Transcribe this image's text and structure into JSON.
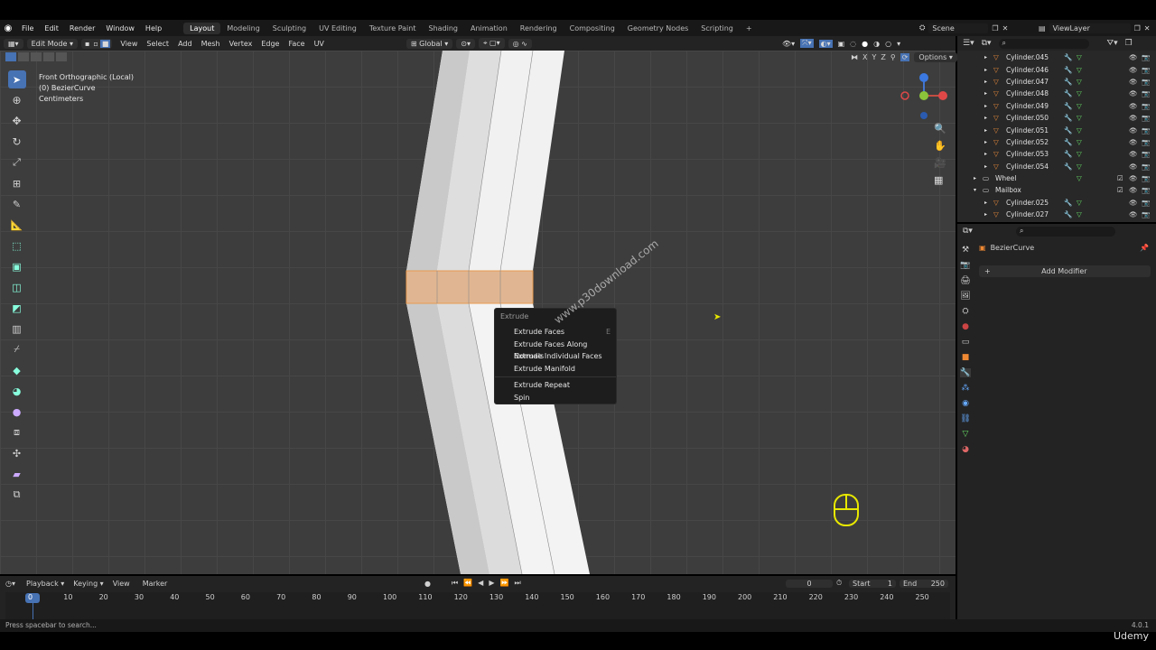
{
  "menu": [
    "File",
    "Edit",
    "Render",
    "Window",
    "Help"
  ],
  "workspaces": [
    "Layout",
    "Modeling",
    "Sculpting",
    "UV Editing",
    "Texture Paint",
    "Shading",
    "Animation",
    "Rendering",
    "Compositing",
    "Geometry Nodes",
    "Scripting",
    "+"
  ],
  "scene": {
    "label": "Scene",
    "view_layer": "ViewLayer"
  },
  "viewport_header": {
    "mode": "Edit Mode",
    "menus": [
      "View",
      "Select",
      "Add",
      "Mesh",
      "Vertex",
      "Edge",
      "Face",
      "UV"
    ],
    "transform": "Global",
    "options": "Options",
    "axes": [
      "X",
      "Y",
      "Z"
    ]
  },
  "viewport_info": {
    "view": "Front Orthographic (Local)",
    "object": "(0) BezierCurve",
    "units": "Centimeters"
  },
  "context_menu": {
    "title": "Extrude",
    "items": [
      {
        "label": "Extrude Faces",
        "shortcut": "E"
      },
      {
        "label": "Extrude Faces Along Normals",
        "shortcut": ""
      },
      {
        "label": "Extrude Individual Faces",
        "shortcut": ""
      },
      {
        "label": "Extrude Manifold",
        "shortcut": ""
      },
      {
        "label": "Extrude Repeat",
        "shortcut": "",
        "sep_before": true
      },
      {
        "label": "Spin",
        "shortcut": ""
      }
    ]
  },
  "watermark": "www.p30download.com",
  "outliner": {
    "rows": [
      {
        "name": "Cylinder.045",
        "indent": 2
      },
      {
        "name": "Cylinder.046",
        "indent": 2
      },
      {
        "name": "Cylinder.047",
        "indent": 2
      },
      {
        "name": "Cylinder.048",
        "indent": 2
      },
      {
        "name": "Cylinder.049",
        "indent": 2
      },
      {
        "name": "Cylinder.050",
        "indent": 2
      },
      {
        "name": "Cylinder.051",
        "indent": 2
      },
      {
        "name": "Cylinder.052",
        "indent": 2
      },
      {
        "name": "Cylinder.053",
        "indent": 2
      },
      {
        "name": "Cylinder.054",
        "indent": 2
      },
      {
        "name": "Wheel",
        "indent": 1
      },
      {
        "name": "Mailbox",
        "indent": 1
      },
      {
        "name": "Cylinder.025",
        "indent": 2
      },
      {
        "name": "Cylinder.027",
        "indent": 2
      }
    ]
  },
  "properties": {
    "object": "BezierCurve",
    "add_modifier": "Add Modifier"
  },
  "timeline": {
    "menus": [
      "Playback",
      "Keying",
      "View",
      "Marker"
    ],
    "current_frame": "0",
    "start_label": "Start",
    "start": "1",
    "end_label": "End",
    "end": "250",
    "ticks": [
      "0",
      "10",
      "20",
      "30",
      "40",
      "50",
      "60",
      "70",
      "80",
      "90",
      "100",
      "110",
      "120",
      "130",
      "140",
      "150",
      "160",
      "170",
      "180",
      "190",
      "200",
      "210",
      "220",
      "230",
      "240",
      "250"
    ]
  },
  "status": {
    "hint": "Press spacebar to search...",
    "version": "4.0.1",
    "brand": "Udemy"
  },
  "colors": {
    "accent": "#4772b3",
    "selection": "#e8a060",
    "header": "#232323",
    "viewport": "#3d3d3d"
  }
}
